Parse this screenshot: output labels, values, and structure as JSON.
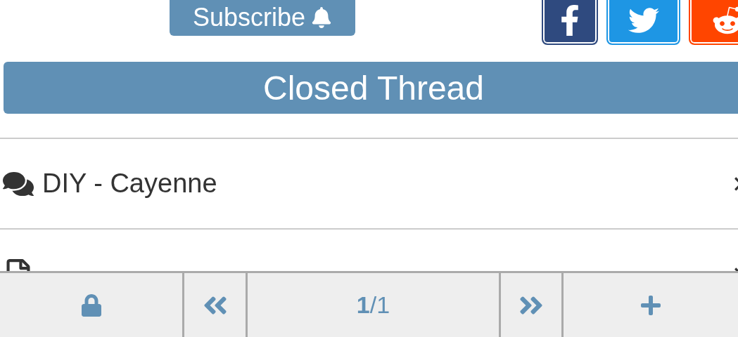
{
  "subscribe_button": {
    "label": "Subscribe"
  },
  "share_buttons": [
    {
      "kind": "facebook"
    },
    {
      "kind": "twitter"
    },
    {
      "kind": "reddit"
    }
  ],
  "status_banner": "Closed Thread",
  "list_items": [
    {
      "kind": "forum",
      "label": "DIY - Cayenne"
    },
    {
      "kind": "new_posts"
    }
  ],
  "toolbar": {
    "page": "**1**/1"
  }
}
